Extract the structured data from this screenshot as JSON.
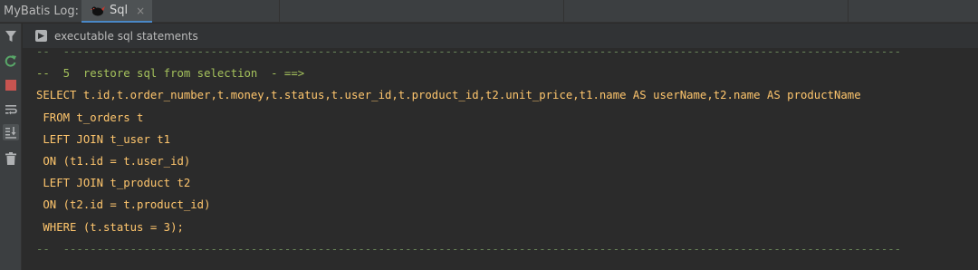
{
  "tool_window": {
    "label": "MyBatis Log:",
    "tab": {
      "label": "Sql",
      "close": "×"
    }
  },
  "header": {
    "text": "executable sql statements"
  },
  "toolbar": {
    "icons": [
      "filter-icon",
      "rerun-icon",
      "stop-icon",
      "soft-wrap-icon",
      "scroll-to-end-icon",
      "clear-icon"
    ]
  },
  "console": {
    "separator_top": "--  -----------------------------------------------------------------------------------------------------------------------------",
    "comment": "--  5  restore sql from selection  - ==>",
    "lines": [
      "SELECT t.id,t.order_number,t.money,t.status,t.user_id,t.product_id,t2.unit_price,t1.name AS userName,t2.name AS productName",
      " FROM t_orders t",
      " LEFT JOIN t_user t1",
      " ON (t1.id = t.user_id)",
      " LEFT JOIN t_product t2",
      " ON (t2.id = t.product_id)",
      " WHERE (t.status = 3);"
    ],
    "separator_bottom": "--  -----------------------------------------------------------------------------------------------------------------------------"
  },
  "colors": {
    "background": "#2b2b2b",
    "separator": "#6a8759",
    "comment": "#a5c25c",
    "sql": "#ffc66d"
  }
}
